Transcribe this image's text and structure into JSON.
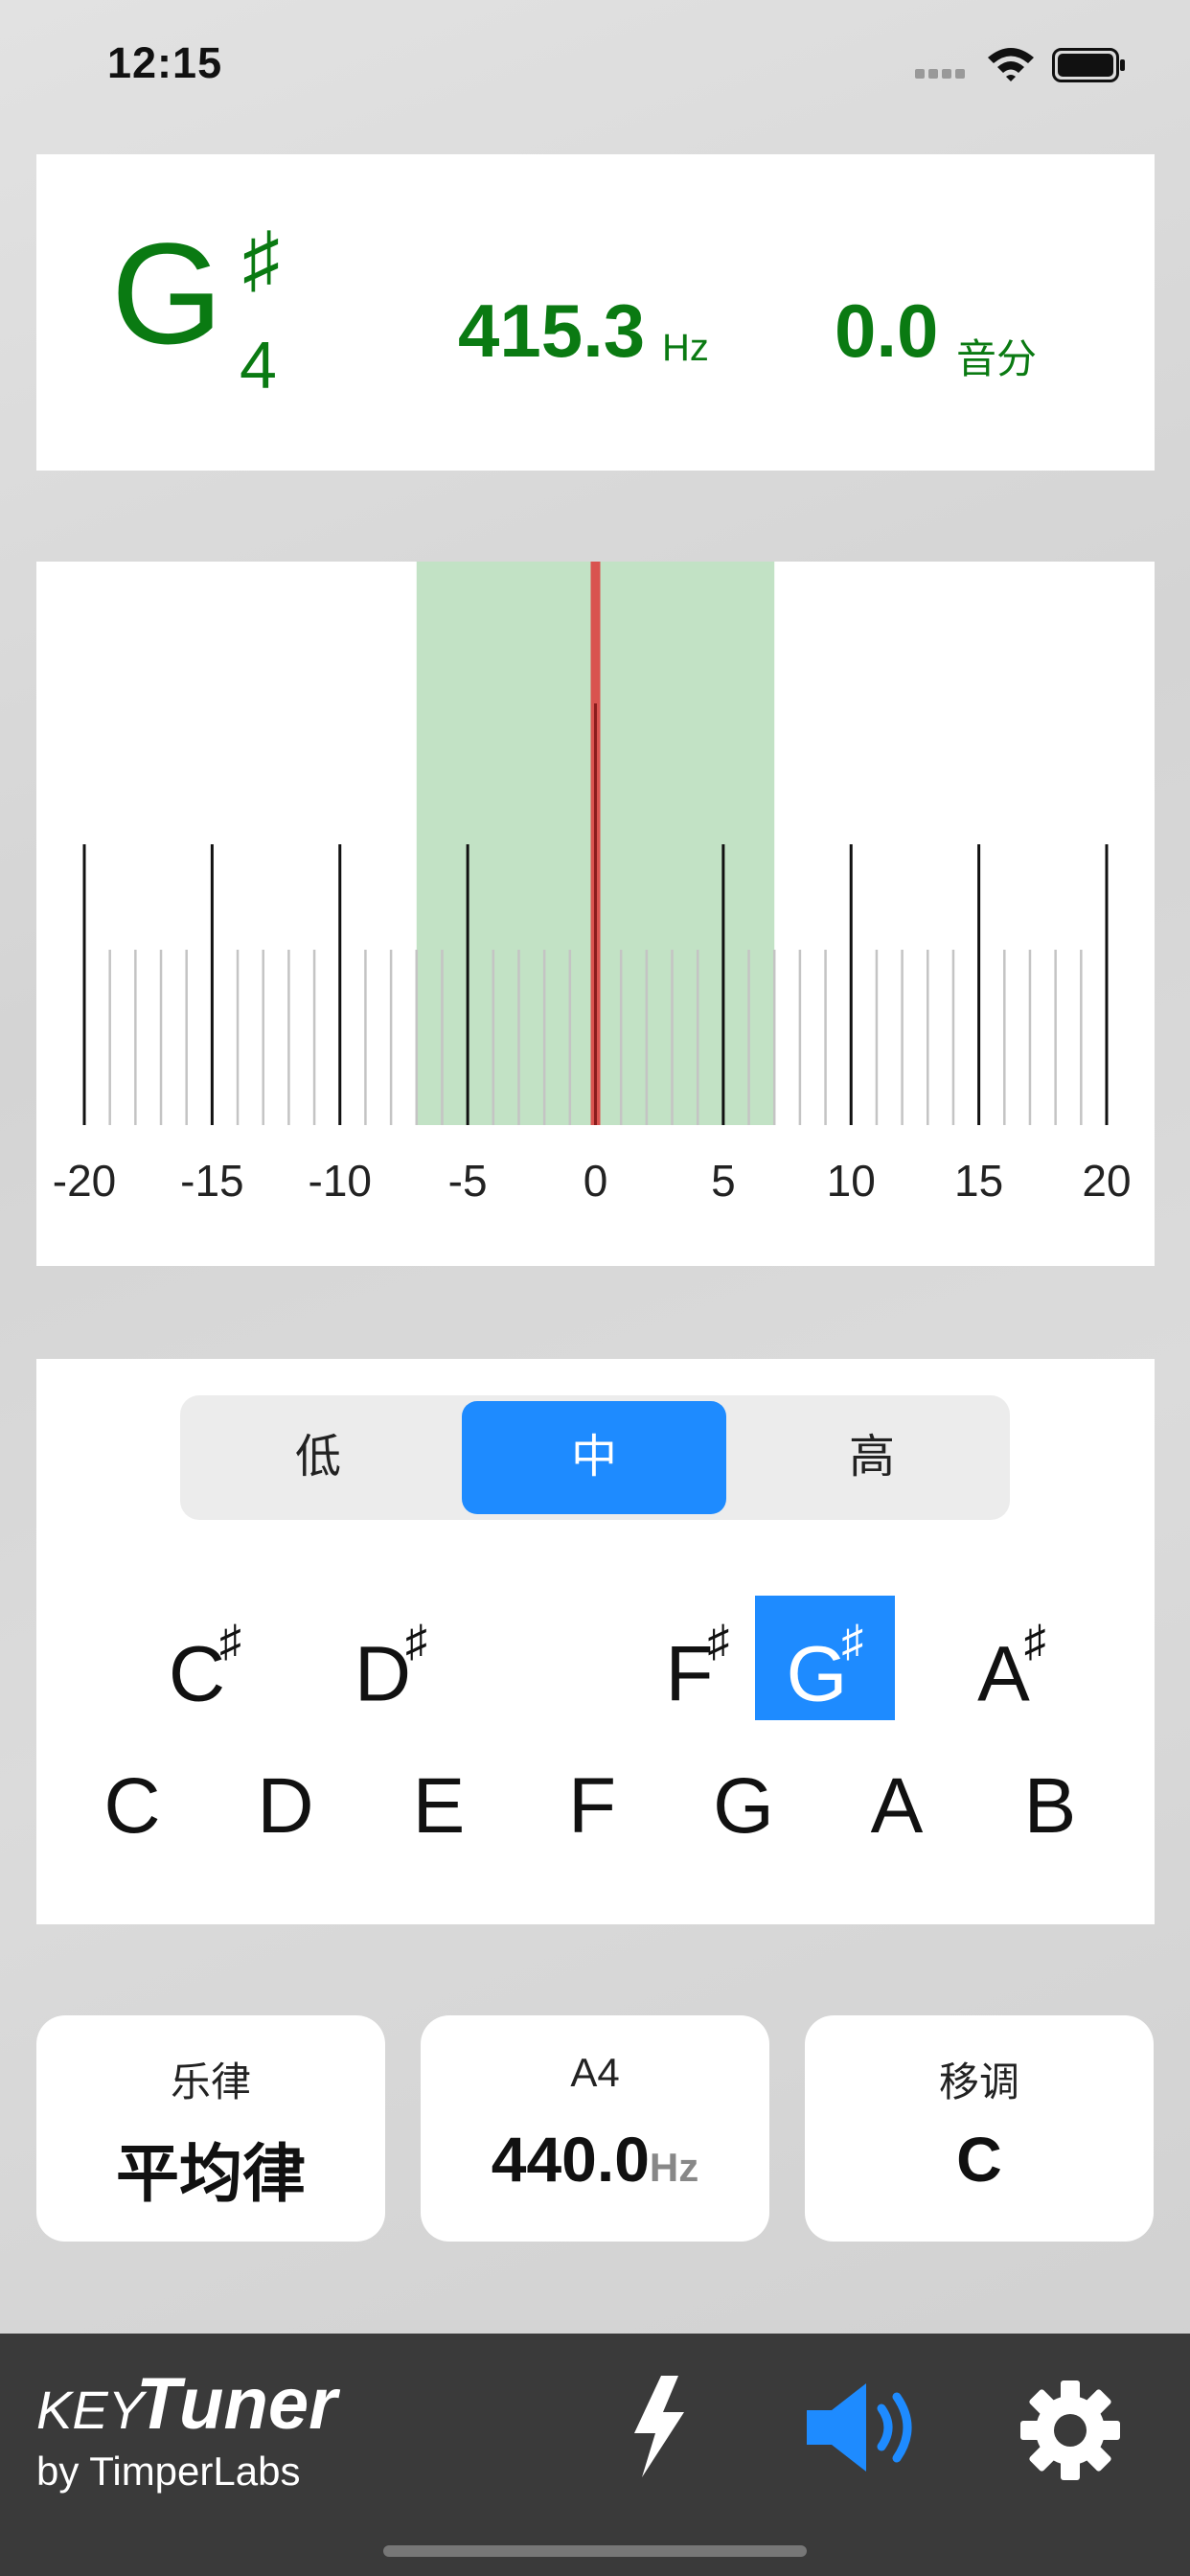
{
  "status_bar": {
    "time": "12:15"
  },
  "note_display": {
    "letter": "G",
    "accidental": "♯",
    "octave": "4",
    "frequency": "415.3",
    "frequency_unit": "Hz",
    "cents": "0.0",
    "cents_unit": "音分"
  },
  "meter": {
    "tick_labels": [
      "-20",
      "-15",
      "-10",
      "-5",
      "0",
      "5",
      "10",
      "15",
      "20"
    ],
    "needle_value": 0,
    "in_tune_range": [
      -7,
      7
    ],
    "range": [
      -20,
      20
    ],
    "colors": {
      "in_tune": "#c2e2c5",
      "needle": "#d9534f"
    }
  },
  "octave_selector": {
    "options": [
      "低",
      "中",
      "高"
    ],
    "selected": "中"
  },
  "keyboard": {
    "sharps": [
      {
        "label": "C",
        "accidental": "♯"
      },
      {
        "label": "D",
        "accidental": "♯"
      },
      {
        "label": "F",
        "accidental": "♯"
      },
      {
        "label": "G",
        "accidental": "♯"
      },
      {
        "label": "A",
        "accidental": "♯"
      }
    ],
    "naturals": [
      "C",
      "D",
      "E",
      "F",
      "G",
      "A",
      "B"
    ],
    "selected": "G♯"
  },
  "settings": {
    "temperament": {
      "label": "乐律",
      "value": "平均律"
    },
    "reference": {
      "label": "A4",
      "value": "440.0",
      "unit": "Hz"
    },
    "transpose": {
      "label": "移调",
      "value": "C"
    }
  },
  "bottom_bar": {
    "brand_key": "KEY",
    "brand_tuner": "Tuner",
    "brand_by": "by TimperLabs",
    "icons": [
      "lightning-icon",
      "speaker-icon",
      "gear-icon"
    ],
    "accent": "#1e8bff"
  }
}
